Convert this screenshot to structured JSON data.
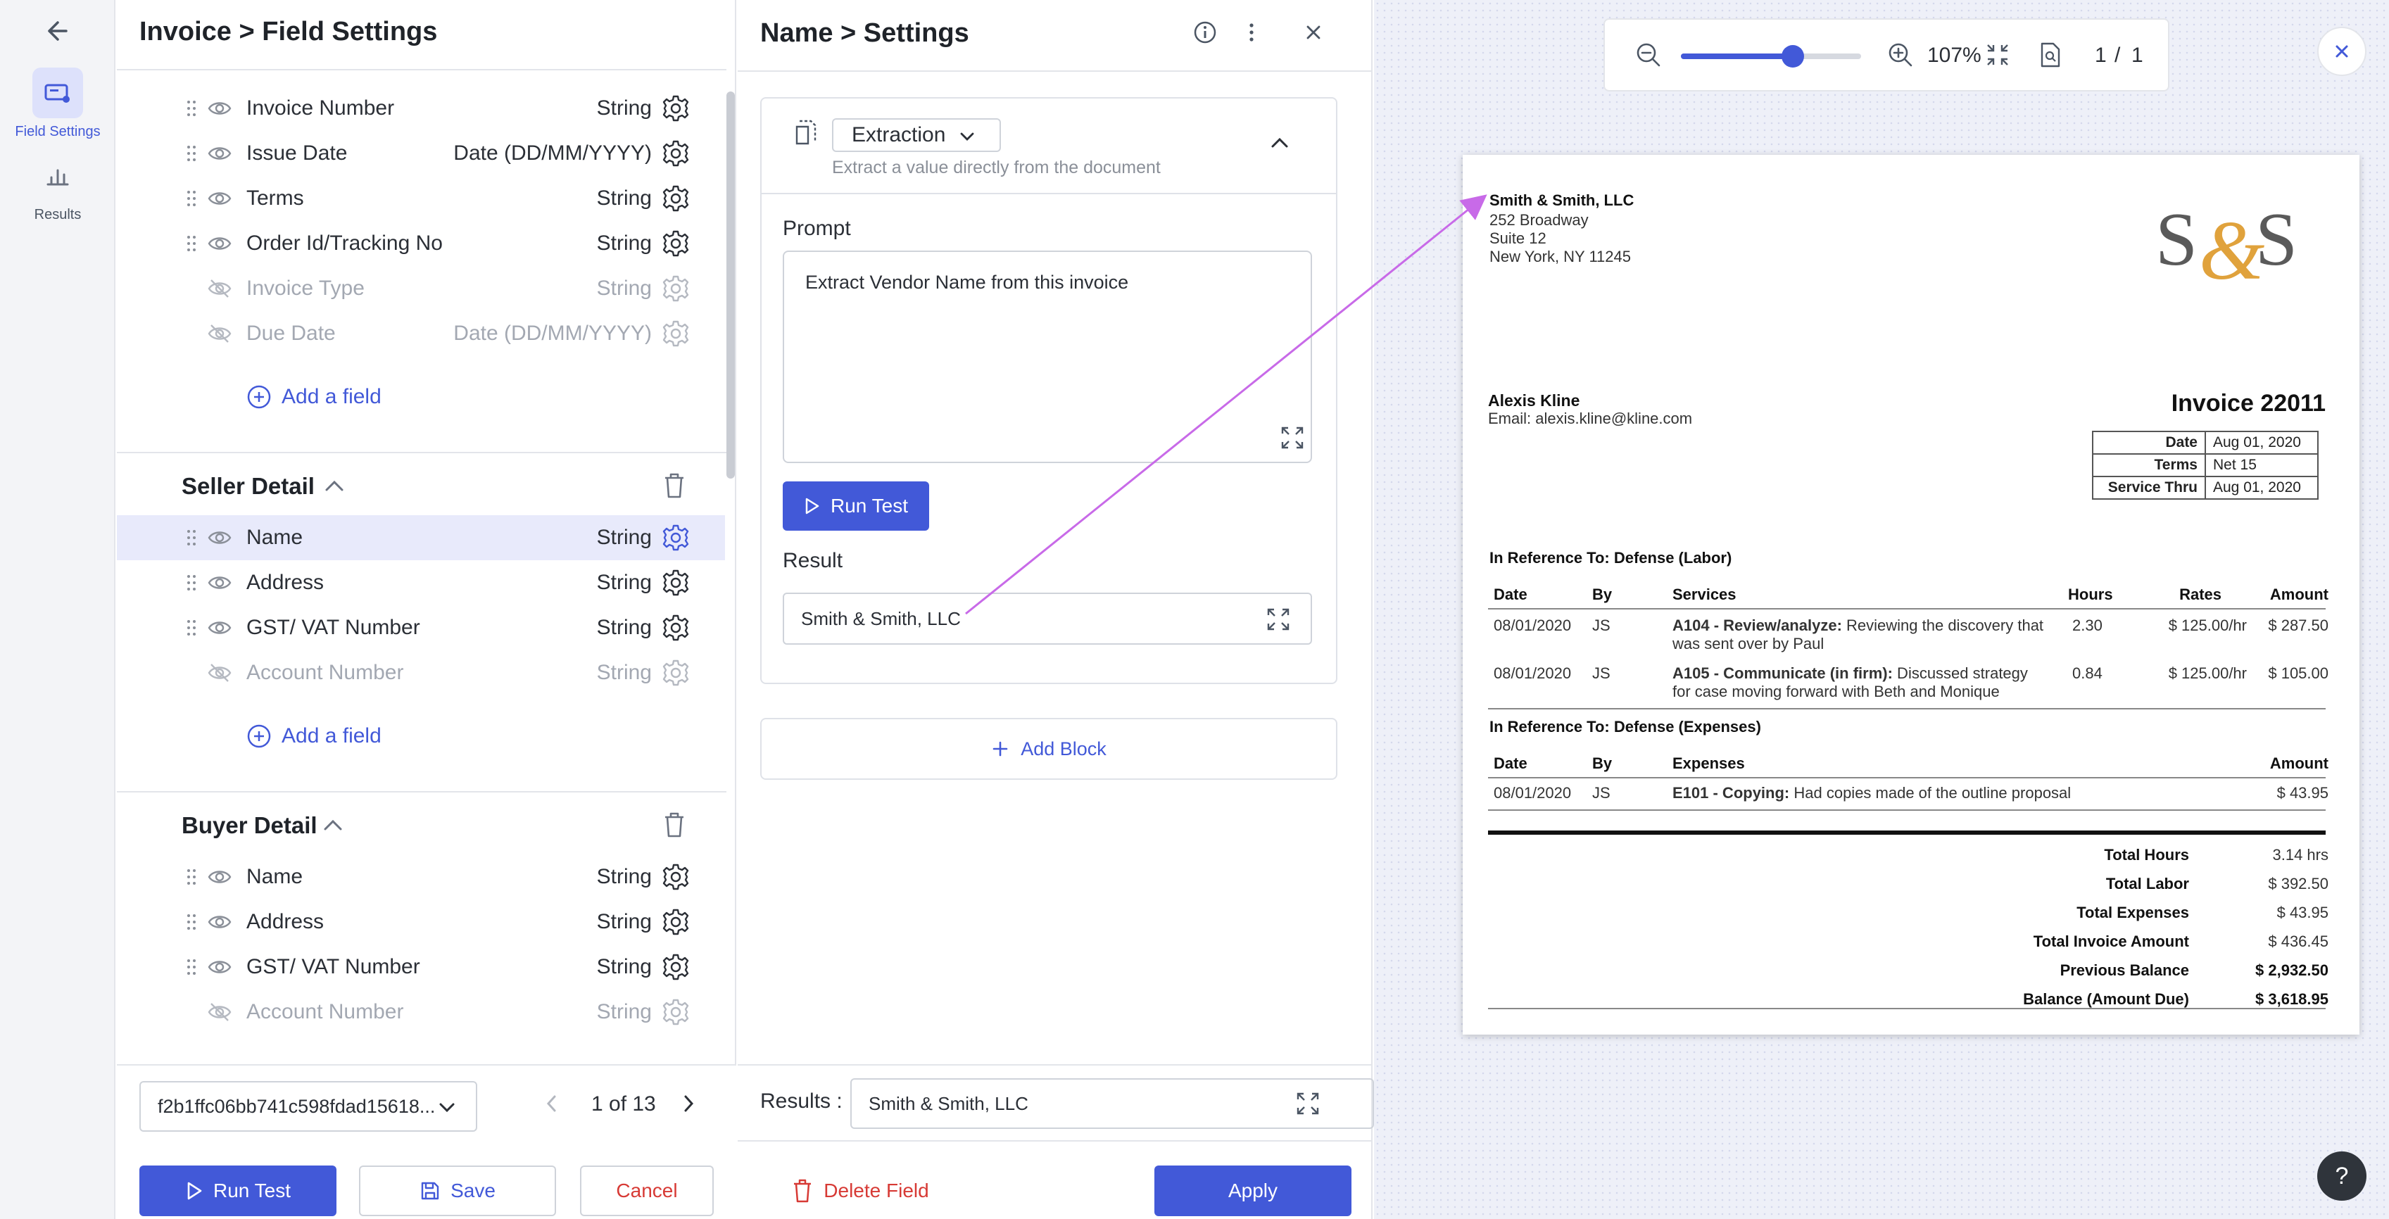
{
  "rail": {
    "field_settings_label": "Field Settings",
    "results_label": "Results"
  },
  "fields_panel": {
    "title": "Invoice > Field Settings",
    "invoice_fields": [
      {
        "name": "Invoice Number",
        "type": "String",
        "visible": true
      },
      {
        "name": "Issue Date",
        "type": "Date (DD/MM/YYYY)",
        "visible": true
      },
      {
        "name": "Terms",
        "type": "String",
        "visible": true
      },
      {
        "name": "Order Id/Tracking No",
        "type": "String",
        "visible": true
      },
      {
        "name": "Invoice Type",
        "type": "String",
        "visible": false
      },
      {
        "name": "Due Date",
        "type": "Date (DD/MM/YYYY)",
        "visible": false
      }
    ],
    "add_field_label": "Add a field",
    "seller_section": {
      "title": "Seller Detail",
      "fields": [
        {
          "name": "Name",
          "type": "String",
          "visible": true,
          "selected": true
        },
        {
          "name": "Address",
          "type": "String",
          "visible": true
        },
        {
          "name": "GST/ VAT Number",
          "type": "String",
          "visible": true
        },
        {
          "name": "Account Number",
          "type": "String",
          "visible": false
        }
      ]
    },
    "buyer_section": {
      "title": "Buyer Detail",
      "fields": [
        {
          "name": "Name",
          "type": "String",
          "visible": true
        },
        {
          "name": "Address",
          "type": "String",
          "visible": true
        },
        {
          "name": "GST/ VAT Number",
          "type": "String",
          "visible": true
        },
        {
          "name": "Account Number",
          "type": "String",
          "visible": false
        }
      ]
    },
    "footer": {
      "document_id": "f2b1ffc06bb741c598fdad15618...",
      "pager": "1 of 13",
      "run_test": "Run Test",
      "save": "Save",
      "cancel": "Cancel"
    }
  },
  "settings_panel": {
    "title": "Name > Settings",
    "block_type": "Extraction",
    "block_hint": "Extract a value directly from the document",
    "prompt_label": "Prompt",
    "prompt_value": "Extract Vendor Name from this invoice",
    "run_test": "Run Test",
    "result_label": "Result",
    "result_value": "Smith & Smith, LLC",
    "add_block": "Add Block",
    "footer": {
      "results_label": "Results :",
      "results_value": "Smith & Smith, LLC",
      "delete": "Delete Field",
      "apply": "Apply"
    }
  },
  "viewer": {
    "zoom": "107%",
    "zoom_level": 0.62,
    "page_current": "1",
    "page_sep": "/",
    "page_total": "1",
    "help": "?"
  },
  "invoice": {
    "vendor_name": "Smith & Smith, LLC",
    "vendor_addr1": "252 Broadway",
    "vendor_addr2": "Suite 12",
    "vendor_addr3": "New York, NY 11245",
    "logo_text": "S&S",
    "client_name": "Alexis Kline",
    "client_email": "Email: alexis.kline@kline.com",
    "invoice_title": "Invoice 22011",
    "meta": [
      {
        "k": "Date",
        "v": "Aug 01, 2020"
      },
      {
        "k": "Terms",
        "v": "Net 15"
      },
      {
        "k": "Service Thru",
        "v": "Aug 01, 2020"
      }
    ],
    "labor_heading": "In Reference To: Defense (Labor)",
    "labor_cols": [
      "Date",
      "By",
      "Services",
      "Hours",
      "Rates",
      "Amount"
    ],
    "labor_rows": [
      {
        "date": "08/01/2020",
        "by": "JS",
        "code": "A104 - Review/analyze:",
        "desc1": " Reviewing the discovery that",
        "desc2": "was sent over by Paul",
        "hours": "2.30",
        "rate": "$ 125.00/hr",
        "amount": "$ 287.50"
      },
      {
        "date": "08/01/2020",
        "by": "JS",
        "code": "A105 - Communicate (in firm):",
        "desc1": " Discussed strategy",
        "desc2": "for case moving forward with Beth and Monique",
        "hours": "0.84",
        "rate": "$ 125.00/hr",
        "amount": "$ 105.00"
      }
    ],
    "expense_heading": "In Reference To: Defense (Expenses)",
    "expense_cols": [
      "Date",
      "By",
      "Expenses",
      "Amount"
    ],
    "expense_rows": [
      {
        "date": "08/01/2020",
        "by": "JS",
        "code": "E101 - Copying:",
        "desc": " Had copies made of the outline proposal",
        "amount": "$ 43.95"
      }
    ],
    "totals": [
      {
        "k": "Total Hours",
        "v": "3.14 hrs",
        "bold": false
      },
      {
        "k": "Total Labor",
        "v": "$ 392.50",
        "bold": false
      },
      {
        "k": "Total Expenses",
        "v": "$ 43.95",
        "bold": false
      },
      {
        "k": "Total Invoice Amount",
        "v": "$ 436.45",
        "bold": false
      },
      {
        "k": "Previous Balance",
        "v": "$ 2,932.50",
        "bold": true
      },
      {
        "k": "Balance (Amount Due)",
        "v": "$ 3,618.95",
        "bold": true
      }
    ]
  },
  "colors": {
    "accent": "#4259d8",
    "danger": "#d73a35",
    "selected_row": "#e8eafb",
    "link_arrow": "#c86ae8",
    "logo_gold": "#e0a23c",
    "logo_dark": "#5a5a5a"
  }
}
